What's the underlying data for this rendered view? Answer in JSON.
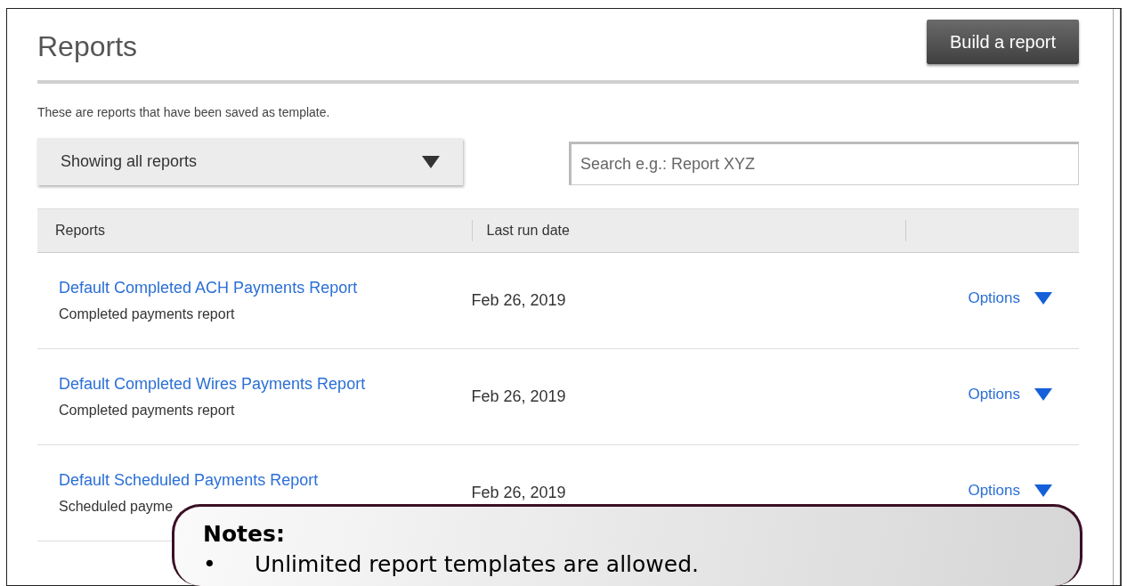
{
  "page": {
    "title": "Reports",
    "build_button": "Build a report",
    "description": "These are reports that have been saved as template.",
    "filter": {
      "value": "Showing all reports"
    },
    "search": {
      "placeholder": "Search e.g.: Report XYZ"
    }
  },
  "table": {
    "columns": [
      "Reports",
      "Last run date"
    ],
    "rows": [
      {
        "name": "Default Completed ACH Payments Report",
        "subtitle": "Completed payments report",
        "last_run": "Feb 26, 2019",
        "options": "Options"
      },
      {
        "name": "Default Completed Wires Payments Report",
        "subtitle": "Completed payments report",
        "last_run": "Feb 26, 2019",
        "options": "Options"
      },
      {
        "name": "Default Scheduled Payments Report",
        "subtitle": "Scheduled payme",
        "last_run": "Feb 26, 2019",
        "options": "Options"
      }
    ]
  },
  "notes": {
    "title": "Notes:",
    "items": [
      {
        "bullet": "•",
        "text": "Unlimited report templates are allowed."
      }
    ]
  }
}
